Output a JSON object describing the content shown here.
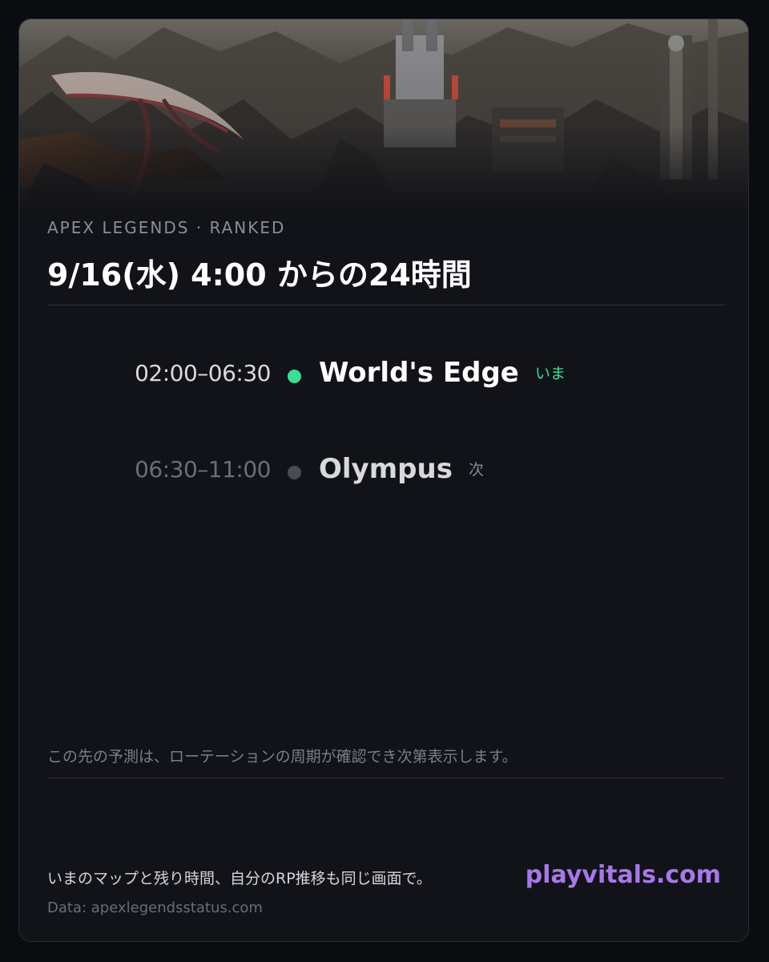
{
  "header": {
    "eyebrow": "APEX LEGENDS · RANKED",
    "title": "9/16(水) 4:00 からの24時間"
  },
  "rotation": [
    {
      "time": "02:00–06:30",
      "map": "World's Edge",
      "tag": "いま",
      "status": "current",
      "dot_color": "#3ddc97",
      "time_color": "#d9dade",
      "map_color": "#ffffff",
      "tag_color": "#3ddc97"
    },
    {
      "time": "06:30–11:00",
      "map": "Olympus",
      "tag": "次",
      "status": "next",
      "dot_color": "#4a4c53",
      "time_color": "#6b6e76",
      "map_color": "#d8d9dd",
      "tag_color": "#8b8d94"
    }
  ],
  "footer": {
    "note": "この先の予測は、ローテーションの周期が確認でき次第表示します。",
    "promo": "いまのマップと残り時間、自分のRP推移も同じ画面で。",
    "data_source": "Data: apexlegendsstatus.com",
    "brand": "playvitals.com"
  },
  "colors": {
    "background": "#0b0c10",
    "card": "#121318",
    "accent": "#a678e8",
    "current": "#3ddc97"
  }
}
